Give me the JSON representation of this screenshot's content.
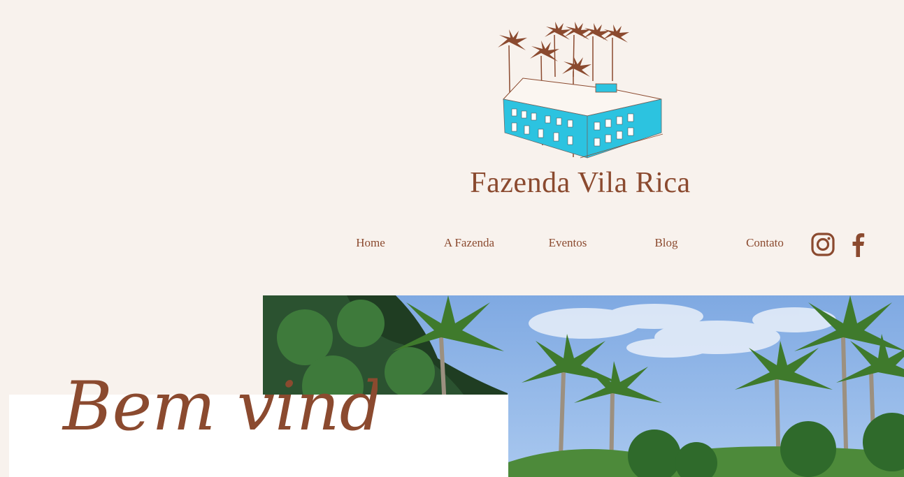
{
  "brand": {
    "name": "Fazenda Vila Rica",
    "logo_icon": "farmhouse-palms-logo-icon"
  },
  "nav": {
    "items": [
      {
        "label": "Home"
      },
      {
        "label": "A Fazenda"
      },
      {
        "label": "Eventos"
      },
      {
        "label": "Blog"
      },
      {
        "label": "Contato"
      }
    ]
  },
  "social": {
    "instagram_icon": "instagram-icon",
    "facebook_icon": "facebook-icon"
  },
  "hero": {
    "welcome_text": "Bem vindo",
    "image_subject": "palm-trees-photo"
  },
  "colors": {
    "background": "#f8f2ed",
    "brand_brown": "#8b4a2f",
    "house_blue": "#2cc3e0",
    "sky": "#8fb8e8"
  }
}
